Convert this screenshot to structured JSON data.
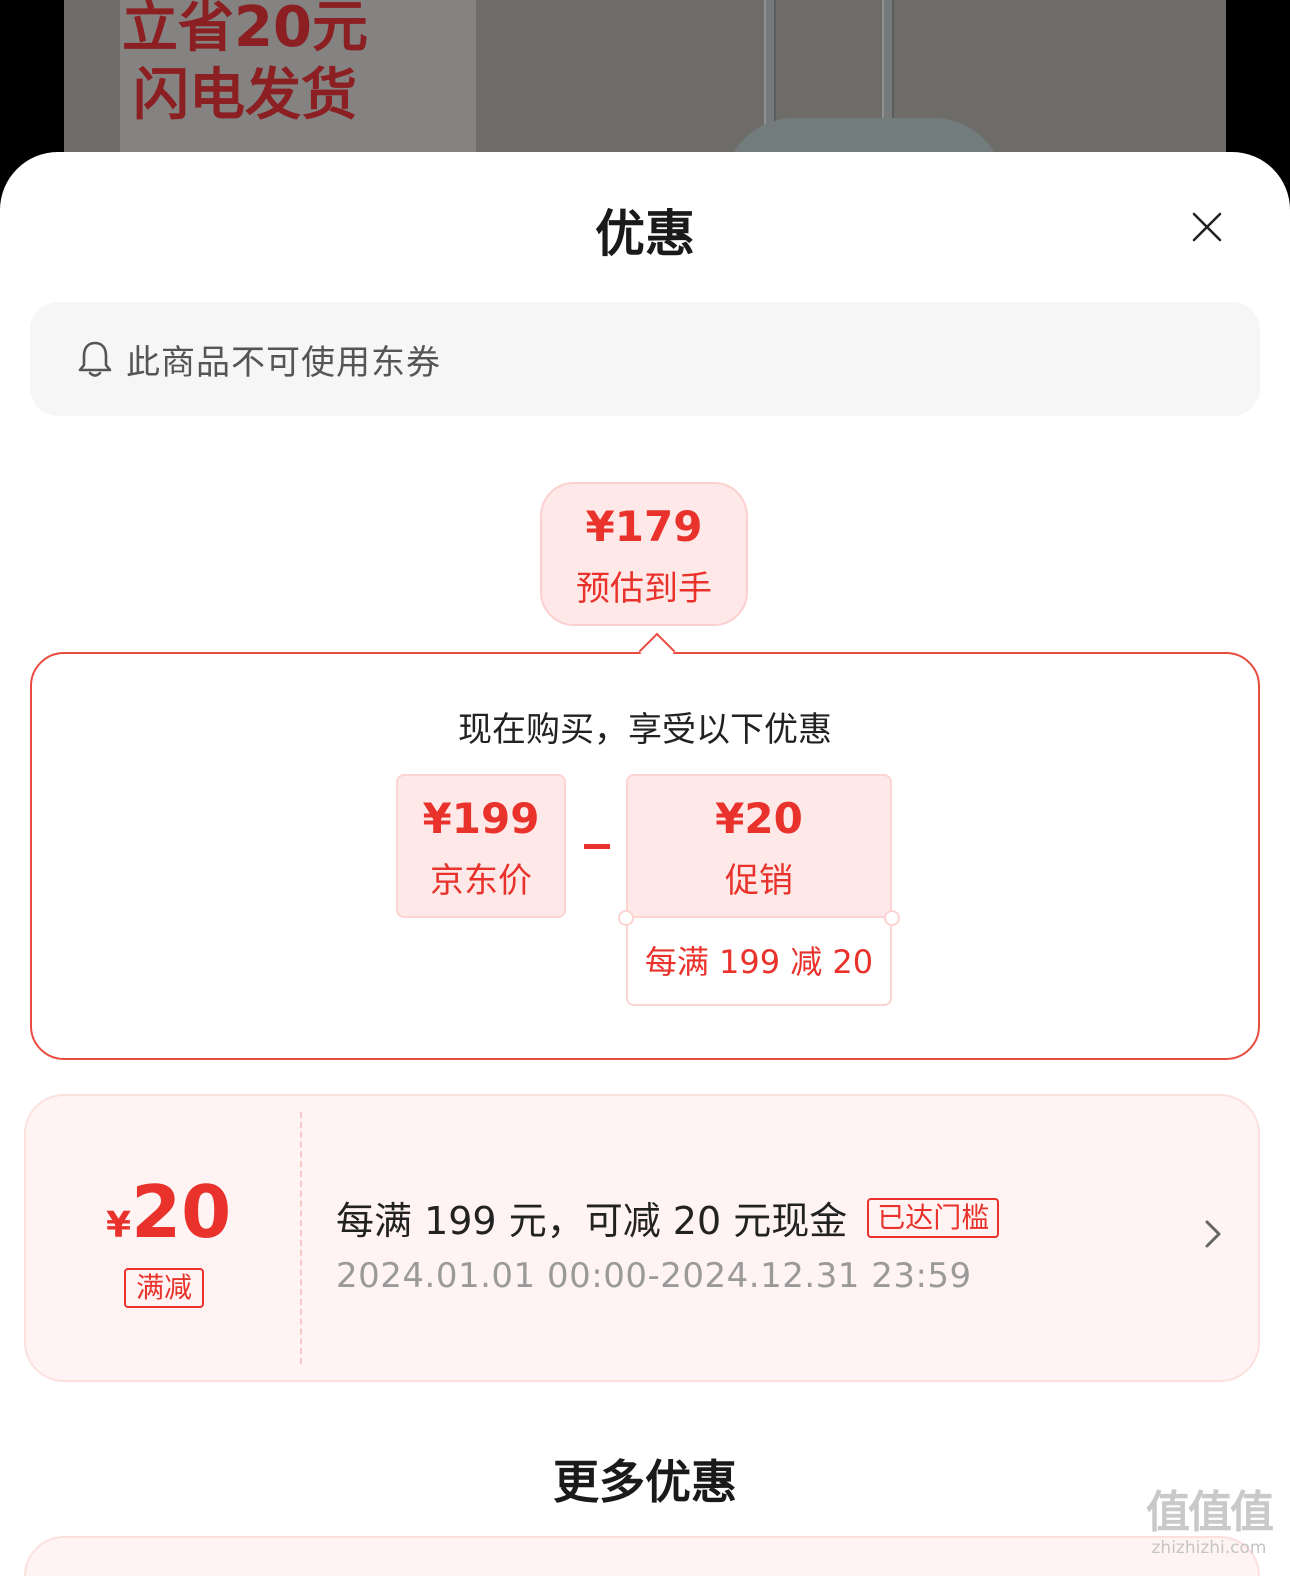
{
  "background": {
    "banner_line1": "立省20元",
    "banner_line2": "闪电发货"
  },
  "sheet": {
    "title": "优惠",
    "close_icon": "close-icon"
  },
  "notice": {
    "icon": "bell-icon",
    "text": "此商品不可使用东券"
  },
  "estimate": {
    "price": "¥179",
    "label": "预估到手"
  },
  "breakdown": {
    "title": "现在购买，享受以下优惠",
    "jd_price": {
      "price": "¥199",
      "label": "京东价"
    },
    "operator": "minus",
    "promotion": {
      "price": "¥20",
      "label": "促销",
      "detail": "每满 199 减 20"
    }
  },
  "coupon": {
    "currency": "¥",
    "amount": "20",
    "type": "满减",
    "description": "每满 199 元，可减 20 元现金",
    "badge": "已达门槛",
    "period": "2024.01.01 00:00-2024.12.31 23:59",
    "chevron_icon": "chevron-right-icon"
  },
  "more": {
    "title": "更多优惠"
  },
  "watermark": {
    "logo": "值值值",
    "site": "zhizhizhi.com"
  },
  "colors": {
    "accent": "#e8322b",
    "accent_light": "#ffe9e8",
    "coupon_bg": "#fff4f3",
    "notice_bg": "#f6f6f6"
  }
}
